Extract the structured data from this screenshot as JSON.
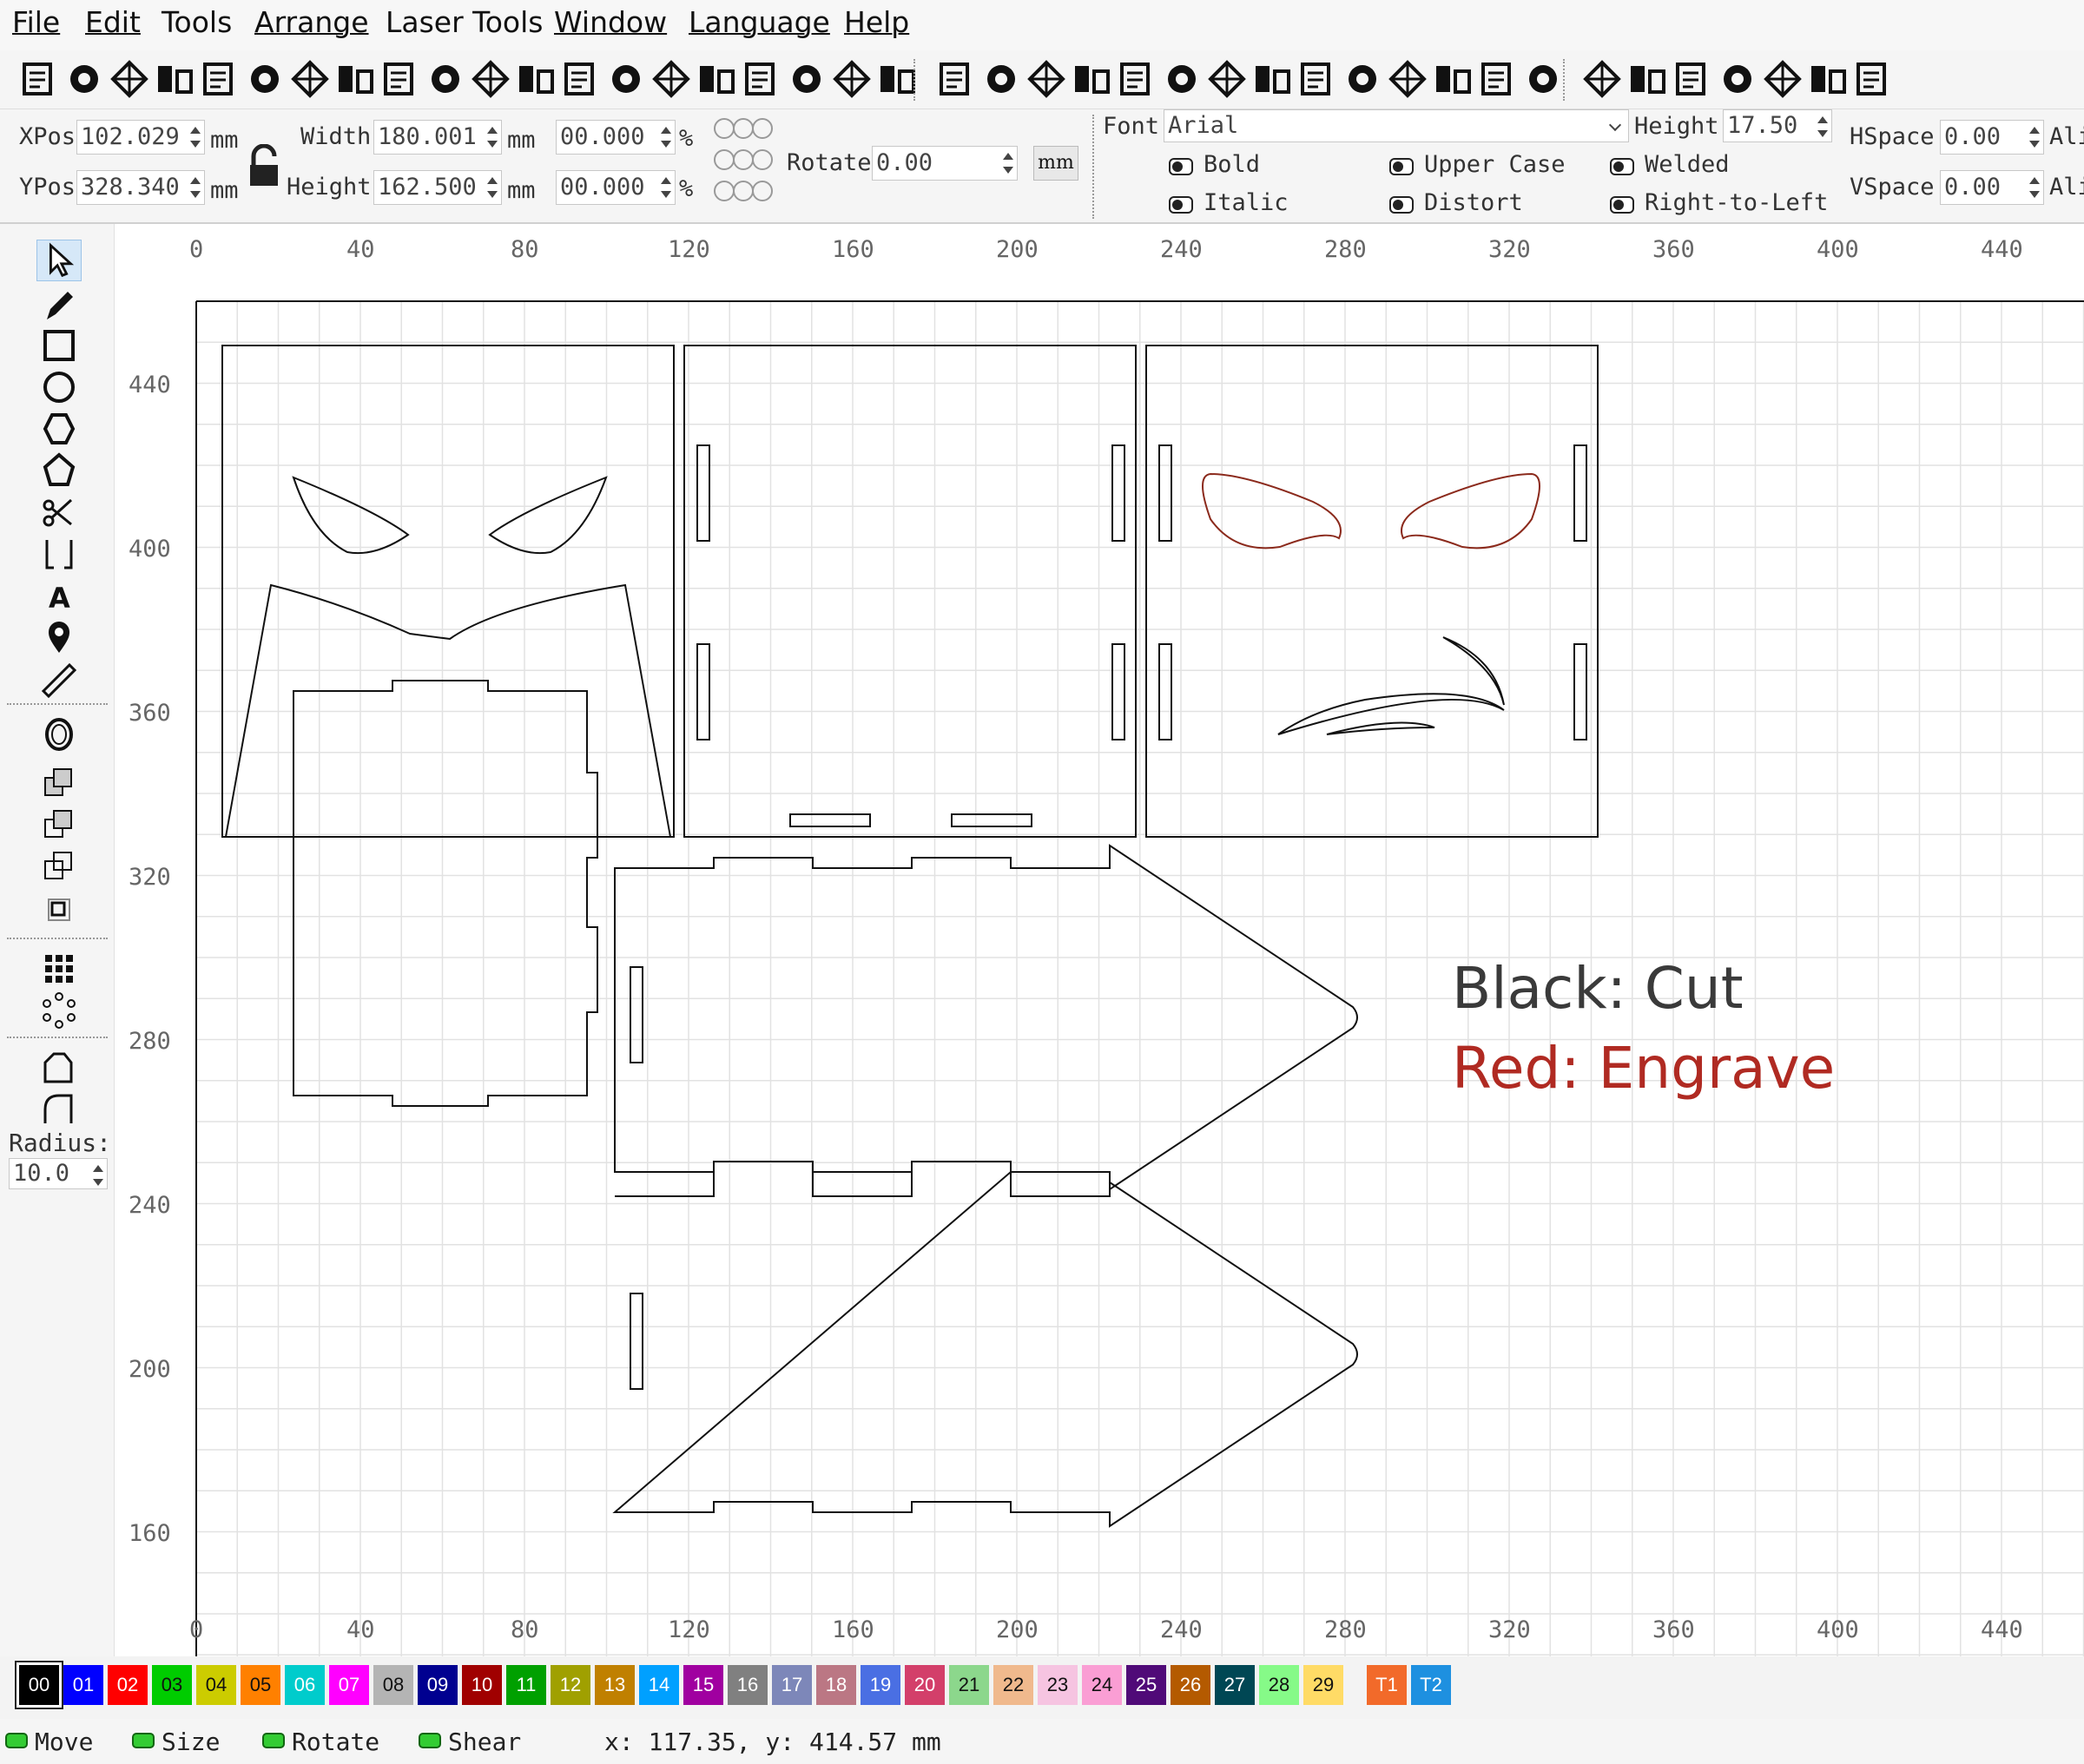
{
  "menu": [
    "File",
    "Edit",
    "Tools",
    "Arrange",
    "Laser Tools",
    "Window",
    "Language",
    "Help"
  ],
  "toolbar_icons": [
    "new-file",
    "open-folder",
    "save",
    "export",
    "undo",
    "redo",
    "cut",
    "copy",
    "paste",
    "delete",
    "move",
    "zoom",
    "zoom-in",
    "zoom-out",
    "select-frame",
    "camera",
    "monitor",
    "settings",
    "tools",
    "group",
    "ungroup",
    "mirror-h",
    "mirror-v",
    "send",
    "target",
    "align-a",
    "align-b",
    "align-c",
    "align-d",
    "align-e",
    "distribute",
    "group2",
    "ungroup2",
    "mirror-h2",
    "mirror-v2",
    "send2",
    "target2",
    "align-f",
    "align-g",
    "align-h",
    "align-i"
  ],
  "props": {
    "xpos_label": "XPos",
    "xpos": "102.029",
    "ypos_label": "YPos",
    "ypos": "328.340",
    "unit": "mm",
    "width_label": "Width",
    "width": "180.001",
    "height_label": "Height",
    "height": "162.500",
    "scale_w": "00.000",
    "scale_h": "00.000",
    "pct": "%",
    "rotate_label": "Rotate",
    "rotate": "0.00",
    "mm_button": "mm",
    "font_label": "Font",
    "font": "Arial",
    "theight_label": "Height",
    "theight": "17.50",
    "hspace_label": "HSpace",
    "hspace": "0.00",
    "vspace_label": "VSpace",
    "vspace": "0.00",
    "align_label": "Ali",
    "align_label2": "Ali",
    "bold": "Bold",
    "italic": "Italic",
    "upper": "Upper Case",
    "distort": "Distort",
    "welded": "Welded",
    "rtl": "Right-to-Left"
  },
  "sidebar": {
    "radius_label": "Radius:",
    "radius": "10.0"
  },
  "ruler": {
    "x": [
      "0",
      "40",
      "80",
      "120",
      "160",
      "200",
      "240",
      "280",
      "320",
      "360",
      "400",
      "440"
    ],
    "y": [
      "440",
      "400",
      "360",
      "320",
      "280",
      "240",
      "200",
      "160"
    ]
  },
  "legend": {
    "cut": "Black: Cut",
    "engrave": "Red: Engrave",
    "cut_color": "#3a3a3a",
    "engrave_color": "#b02a22"
  },
  "palette": [
    {
      "label": "00",
      "color": "#000000"
    },
    {
      "label": "01",
      "color": "#0000ff"
    },
    {
      "label": "02",
      "color": "#ff0000"
    },
    {
      "label": "03",
      "color": "#00cc00"
    },
    {
      "label": "04",
      "color": "#cccc00"
    },
    {
      "label": "05",
      "color": "#ff8000"
    },
    {
      "label": "06",
      "color": "#00cccc"
    },
    {
      "label": "07",
      "color": "#ff00ff"
    },
    {
      "label": "08",
      "color": "#b4b4b4"
    },
    {
      "label": "09",
      "color": "#000090"
    },
    {
      "label": "10",
      "color": "#a00000"
    },
    {
      "label": "11",
      "color": "#00a000"
    },
    {
      "label": "12",
      "color": "#a0a000"
    },
    {
      "label": "13",
      "color": "#c08000"
    },
    {
      "label": "14",
      "color": "#00a0ff"
    },
    {
      "label": "15",
      "color": "#a000a0"
    },
    {
      "label": "16",
      "color": "#808080"
    },
    {
      "label": "17",
      "color": "#7d87b9"
    },
    {
      "label": "18",
      "color": "#bb7784"
    },
    {
      "label": "19",
      "color": "#4a6fe3"
    },
    {
      "label": "20",
      "color": "#d33f6a"
    },
    {
      "label": "21",
      "color": "#8cd78c"
    },
    {
      "label": "22",
      "color": "#f0b98d"
    },
    {
      "label": "23",
      "color": "#f6c4e1"
    },
    {
      "label": "24",
      "color": "#fa9ed4"
    },
    {
      "label": "25",
      "color": "#500a78"
    },
    {
      "label": "26",
      "color": "#b45a00"
    },
    {
      "label": "27",
      "color": "#004754"
    },
    {
      "label": "28",
      "color": "#86fa88"
    },
    {
      "label": "29",
      "color": "#ffdb66"
    },
    {
      "label": "T1",
      "color": "#f26a2a"
    },
    {
      "label": "T2",
      "color": "#1e90e0"
    }
  ],
  "status": {
    "move": "Move",
    "size": "Size",
    "rotate": "Rotate",
    "shear": "Shear",
    "coords": "x: 117.35, y: 414.57 mm"
  }
}
